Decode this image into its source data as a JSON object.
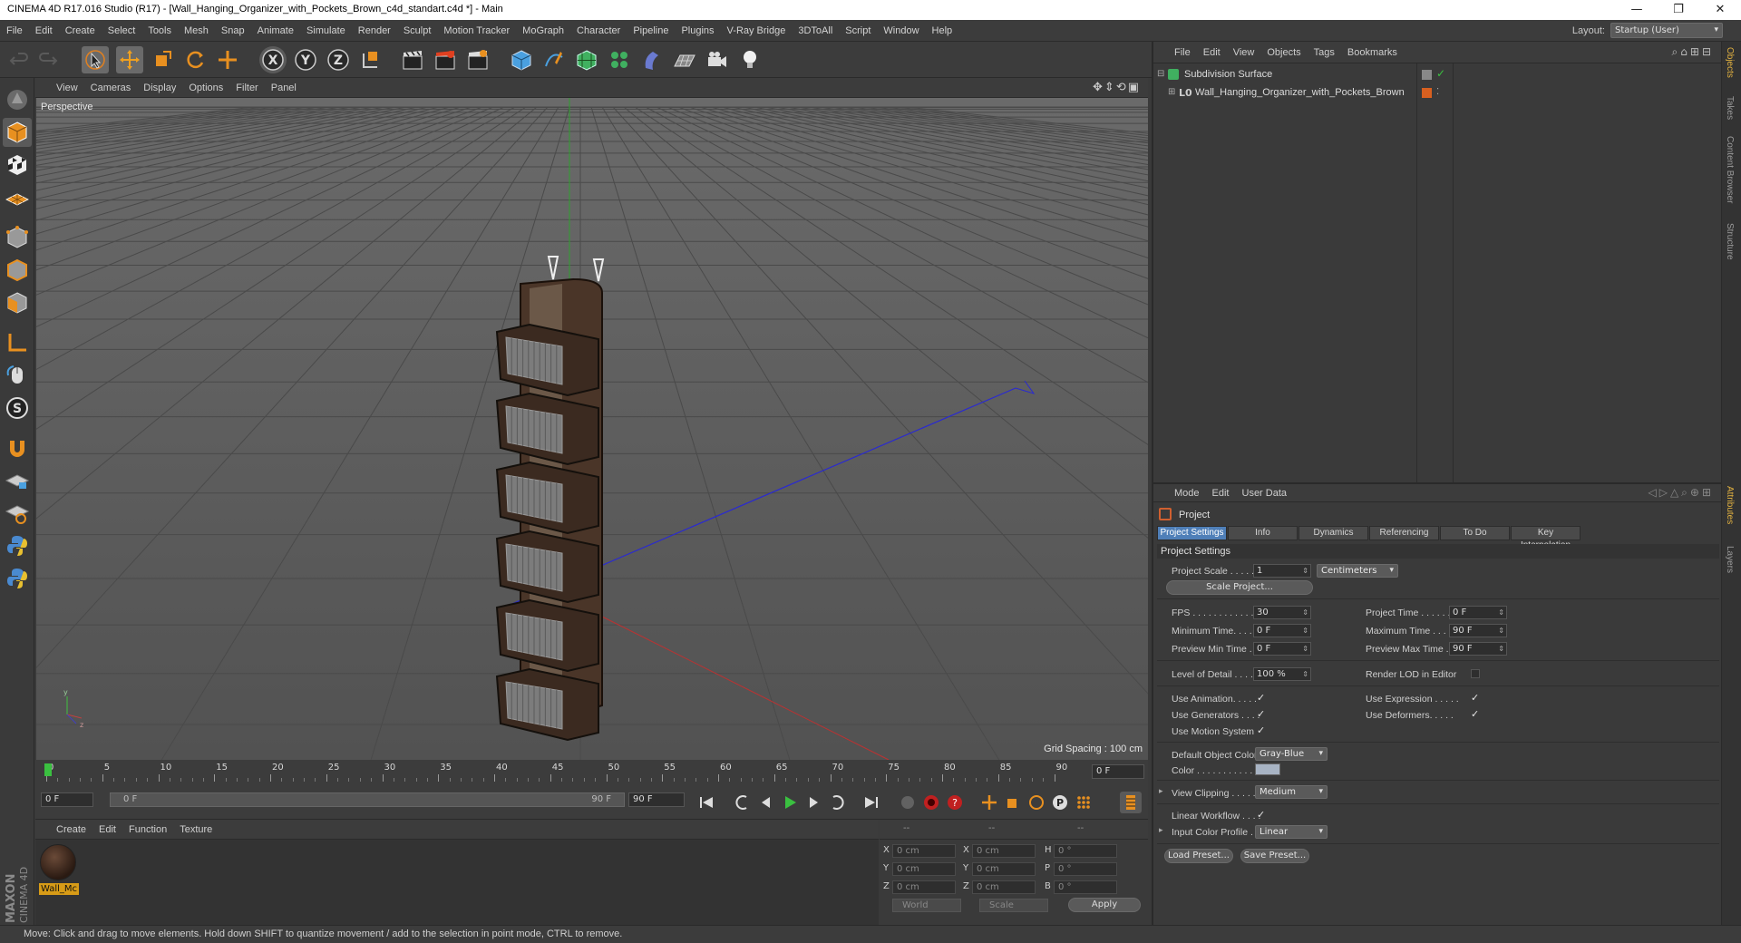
{
  "window": {
    "title": "CINEMA 4D R17.016 Studio (R17) - [Wall_Hanging_Organizer_with_Pockets_Brown_c4d_standart.c4d *] - Main",
    "controls": [
      "minimize-icon",
      "restore-icon",
      "close-icon"
    ]
  },
  "menubar": {
    "items": [
      "File",
      "Edit",
      "Create",
      "Select",
      "Tools",
      "Mesh",
      "Snap",
      "Animate",
      "Simulate",
      "Render",
      "Sculpt",
      "Motion Tracker",
      "MoGraph",
      "Character",
      "Pipeline",
      "Plugins",
      "V-Ray Bridge",
      "3DToAll",
      "Script",
      "Window",
      "Help"
    ],
    "layout_label": "Layout:",
    "layout_value": "Startup (User)"
  },
  "viewport": {
    "menu": [
      "View",
      "Cameras",
      "Display",
      "Options",
      "Filter",
      "Panel"
    ],
    "camera_label": "Perspective",
    "grid_spacing": "Grid Spacing : 100 cm"
  },
  "timeline": {
    "ticks": [
      "0",
      "5",
      "10",
      "15",
      "20",
      "25",
      "30",
      "35",
      "40",
      "45",
      "50",
      "55",
      "60",
      "65",
      "70",
      "75",
      "80",
      "85",
      "90"
    ],
    "current_frame": "0 F",
    "start_field": "0 F",
    "range_start": "0 F",
    "range_end": "90 F",
    "end_field": "90 F"
  },
  "material_manager": {
    "menu": [
      "Create",
      "Edit",
      "Function",
      "Texture"
    ],
    "material_name": "Wall_Mc"
  },
  "coordinates": {
    "headers": [
      "--",
      "--",
      "--"
    ],
    "rows": [
      {
        "a": "X",
        "av": "0 cm",
        "b": "X",
        "bv": "0 cm",
        "c": "H",
        "cv": "0 °"
      },
      {
        "a": "Y",
        "av": "0 cm",
        "b": "Y",
        "bv": "0 cm",
        "c": "P",
        "cv": "0 °"
      },
      {
        "a": "Z",
        "av": "0 cm",
        "b": "Z",
        "bv": "0 cm",
        "c": "B",
        "cv": "0 °"
      }
    ],
    "space": "World",
    "mode": "Scale",
    "apply": "Apply"
  },
  "status": "Move: Click and drag to move elements. Hold down SHIFT to quantize movement / add to the selection in point mode, CTRL to remove.",
  "object_manager": {
    "menu": [
      "File",
      "Edit",
      "View",
      "Objects",
      "Tags",
      "Bookmarks"
    ],
    "objects": [
      "Subdivision Surface",
      "Wall_Hanging_Organizer_with_Pockets_Brown"
    ]
  },
  "attributes": {
    "menu": [
      "Mode",
      "Edit",
      "User Data"
    ],
    "title": "Project",
    "tabs": [
      "Project Settings",
      "Info",
      "Dynamics",
      "Referencing",
      "To Do",
      "Key Interpolation"
    ],
    "section": "Project Settings",
    "project_scale_label": "Project Scale . . . . . .",
    "project_scale": "1",
    "project_scale_unit": "Centimeters",
    "scale_project_btn": "Scale Project...",
    "fps_label": "FPS . . . . . . . . . . . . . .",
    "fps": "30",
    "project_time_label": "Project Time . . . . . . .",
    "project_time": "0 F",
    "min_time_label": "Minimum Time. . . . . .",
    "min_time": "0 F",
    "max_time_label": "Maximum Time . . . . .",
    "max_time": "90 F",
    "prev_min_label": "Preview Min Time . .",
    "prev_min": "0 F",
    "prev_max_label": "Preview Max Time . . .",
    "prev_max": "90 F",
    "lod_label": "Level of Detail . . . . .",
    "lod": "100 %",
    "render_lod_label": "Render LOD in Editor",
    "use_anim_label": "Use Animation. . . . .",
    "use_expr_label": "Use Expression . . . . .",
    "use_gen_label": "Use Generators . . . .",
    "use_def_label": "Use Deformers. . . . .",
    "use_motion_label": "Use Motion System",
    "def_obj_color_label": "Default Object Color",
    "def_obj_color": "Gray-Blue",
    "color_label": "Color . . . . . . . . . . . .",
    "color_swatch": "#a8b4c4",
    "view_clipping_label": "View Clipping . . . . .",
    "view_clipping": "Medium",
    "linear_wf_label": "Linear Workflow . . . .",
    "input_cp_label": "Input Color Profile . .",
    "input_cp": "Linear",
    "load_preset": "Load Preset...",
    "save_preset": "Save Preset..."
  },
  "side_tabs": [
    "Objects",
    "Takes",
    "Content Browser",
    "Structure",
    "Attributes",
    "Layers"
  ],
  "colors": {
    "accent_blue": "#4f7fb8",
    "material_orange": "#d79b17",
    "object_brown": "#5a4638"
  }
}
